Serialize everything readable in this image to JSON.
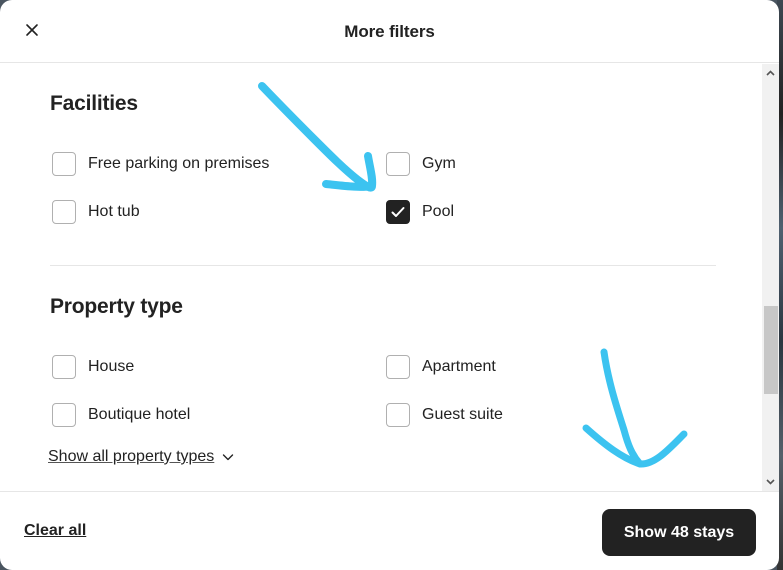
{
  "header": {
    "title": "More filters",
    "close_icon": "close-icon"
  },
  "sections": {
    "facilities": {
      "title": "Facilities",
      "options": [
        {
          "label": "Free parking on premises",
          "checked": false
        },
        {
          "label": "Gym",
          "checked": false
        },
        {
          "label": "Hot tub",
          "checked": false
        },
        {
          "label": "Pool",
          "checked": true
        }
      ]
    },
    "property_type": {
      "title": "Property type",
      "options": [
        {
          "label": "House",
          "checked": false
        },
        {
          "label": "Apartment",
          "checked": false
        },
        {
          "label": "Boutique hotel",
          "checked": false
        },
        {
          "label": "Guest suite",
          "checked": false
        }
      ],
      "show_all_label": "Show all property types"
    }
  },
  "footer": {
    "clear_all_label": "Clear all",
    "show_button_label": "Show 48 stays"
  },
  "scrollbar": {
    "position_fraction": 0.62
  },
  "colors": {
    "primary_text": "#222222",
    "button_bg": "#222222",
    "annotation_arrow": "#3cc3f0",
    "divider": "#e6e6e6"
  }
}
